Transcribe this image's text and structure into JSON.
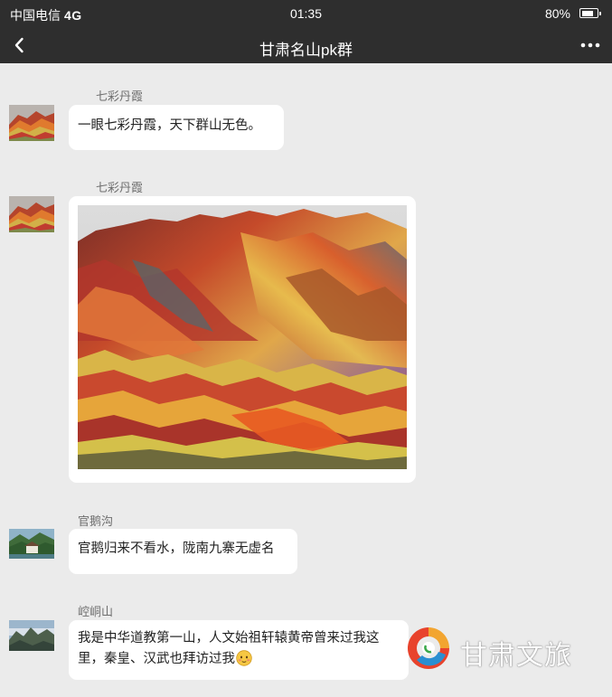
{
  "status_bar": {
    "carrier": "中国电信",
    "network": "4G",
    "time": "01:35",
    "battery": "80%",
    "battery_level": 0.8
  },
  "nav": {
    "back_icon": "chevron-left-icon",
    "title": "甘肃名山pk群",
    "more_icon": "ellipsis-icon"
  },
  "messages": [
    {
      "sender": "七彩丹霞",
      "avatar": "rainbow-mountain-avatar",
      "text": "一眼七彩丹霞，天下群山无色。"
    },
    {
      "sender": "七彩丹霞",
      "avatar": "rainbow-mountain-avatar",
      "image": "rainbow-mountains-photo"
    },
    {
      "sender": "官鹅沟",
      "avatar": "guanegou-avatar",
      "text": "官鹅归来不看水，陇南九寨无虚名"
    },
    {
      "sender": "崆峒山",
      "avatar": "kongtong-avatar",
      "text_line1": "我是中华道教第一山，人文始祖轩辕黄帝曾来过我这",
      "text_line2": "里，秦皇、汉武也拜访过我",
      "emoji": "blushing-face-emoji"
    }
  ],
  "watermark": {
    "text": "甘肃文旅",
    "logo": "gansu-wenlv-logo"
  },
  "colors": {
    "bar_bg": "#2e2e2e",
    "chat_bg": "#ebebeb",
    "bubble_bg": "#ffffff",
    "sender_text": "#6e6e6e"
  }
}
